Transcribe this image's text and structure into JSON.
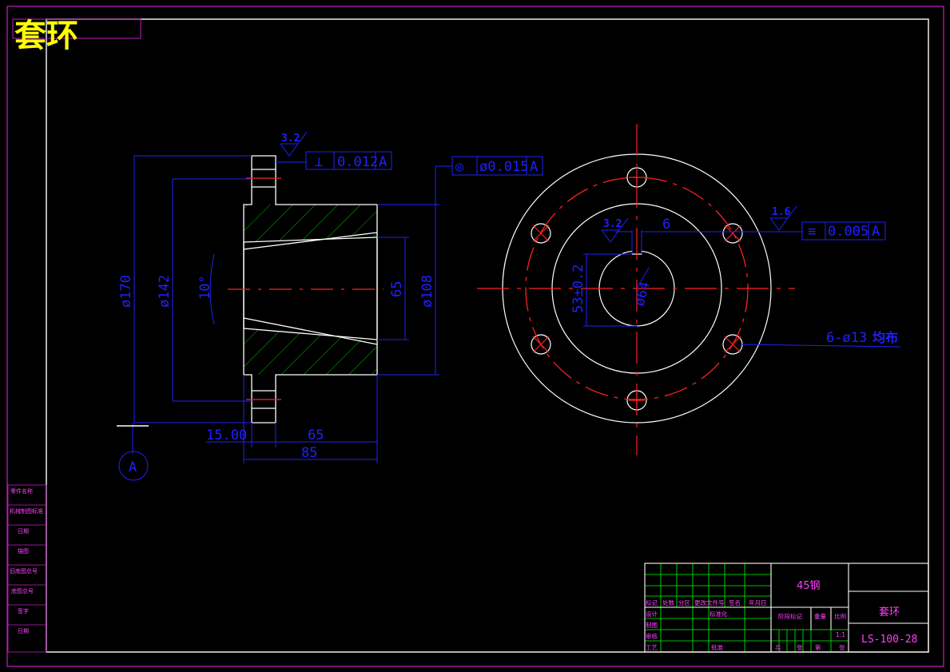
{
  "title_corner": "套环",
  "colors": {
    "frame": "#c020c0",
    "outline": "#ffffff",
    "dim": "#2020ff",
    "center": "#ff2020",
    "hatch": "#00c000",
    "title_text": "#ffff00",
    "grid": "#00ff00",
    "label": "#ff40ff"
  },
  "left_view": {
    "dims": {
      "d170": "ø170",
      "d142": "ø142",
      "d108": "ø108",
      "d65": "65",
      "angle": "10°",
      "w15": "15.00",
      "w65": "65",
      "w85": "85"
    },
    "roughness": "3.2",
    "tolerance_perp": {
      "symbol": "⊥",
      "value": "0.012",
      "datum": "A"
    },
    "tolerance_conc": {
      "symbol": "◎",
      "value": "ø0.015",
      "datum": "A"
    },
    "datum_label": "A"
  },
  "right_view": {
    "dims": {
      "d64": "ø64",
      "key_width": "6",
      "key_depth": "53±0.2",
      "holes": "6-ø13",
      "holes_note": "均布"
    },
    "roughness_key": "3.2",
    "roughness_face": "1.6",
    "tolerance_sym": {
      "symbol": "≡",
      "value": "0.005",
      "datum": "A"
    }
  },
  "left_strip": [
    "零件名称",
    "机械制图标准",
    "日期",
    "描图",
    "旧底图总号",
    "底图总号",
    "签字",
    "日期"
  ],
  "title_block": {
    "material": "45钢",
    "part_name": "套环",
    "drawing_no": "LS-100-28",
    "header_row": [
      "标记",
      "处数",
      "分区",
      "更改文件号",
      "签名",
      "年月日"
    ],
    "rows": [
      "设计",
      "制图",
      "审核",
      "工艺"
    ],
    "standard_label": "标准化",
    "approve_label": "批准",
    "stage_label": "阶段标记",
    "weight_label": "重量",
    "scale_label": "比例",
    "scale_value": "1:1",
    "sheet_row": [
      "共",
      "张",
      "第",
      "张"
    ]
  }
}
